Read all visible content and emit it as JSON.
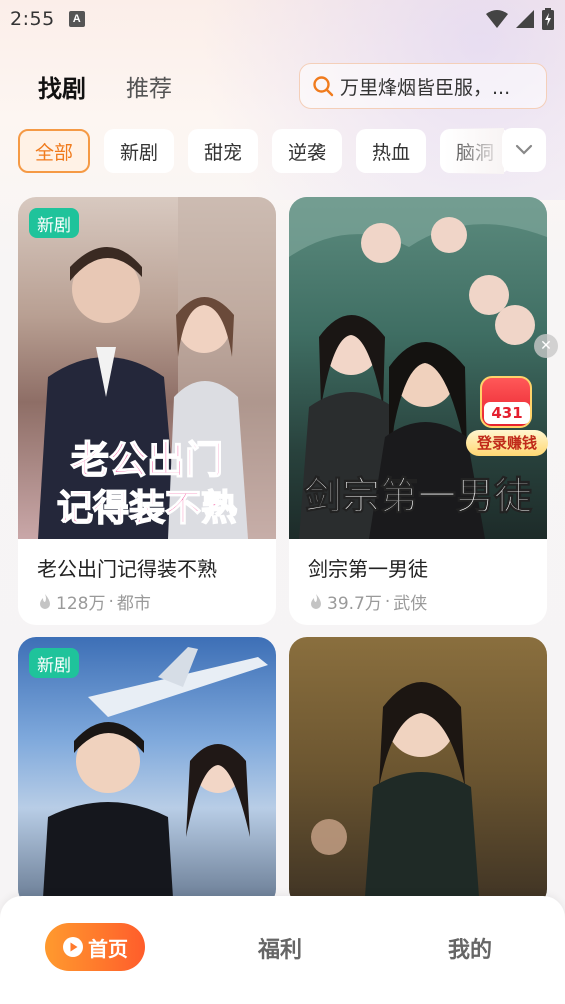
{
  "status_bar": {
    "time": "2:55",
    "notification_badge": "A"
  },
  "header": {
    "tab_active": "找剧",
    "tab_other": "推荐",
    "search_placeholder": "万里烽烟皆臣服，..."
  },
  "filters": {
    "chips": [
      "全部",
      "新剧",
      "甜宠",
      "逆袭",
      "热血",
      "脑洞"
    ],
    "active": "全部",
    "more_icon": "chevron-down-icon"
  },
  "cards": [
    {
      "badge": "新剧",
      "poster_text_1": "老公出门",
      "poster_text_2": "记得装不熟",
      "title": "老公出门记得装不熟",
      "views": "128万",
      "genre": "都市"
    },
    {
      "badge": "",
      "poster_text_1": "剑宗第一男徒",
      "poster_text_2": "",
      "title": "剑宗第一男徒",
      "views": "39.7万",
      "genre": "武侠"
    },
    {
      "badge": "新剧",
      "poster_text_1": "",
      "poster_text_2": "",
      "title": "",
      "views": "",
      "genre": ""
    },
    {
      "badge": "",
      "poster_text_1": "",
      "poster_text_2": "",
      "title": "",
      "views": "",
      "genre": ""
    }
  ],
  "reward": {
    "count": "431",
    "label": "登录赚钱"
  },
  "bottom_nav": {
    "home": "首页",
    "benefits": "福利",
    "mine": "我的"
  },
  "colors": {
    "accent": "#f07b1d",
    "badge_green": "#1fc39b",
    "nav_gradient_start": "#ff9a2e",
    "nav_gradient_end": "#ff5d2b"
  }
}
